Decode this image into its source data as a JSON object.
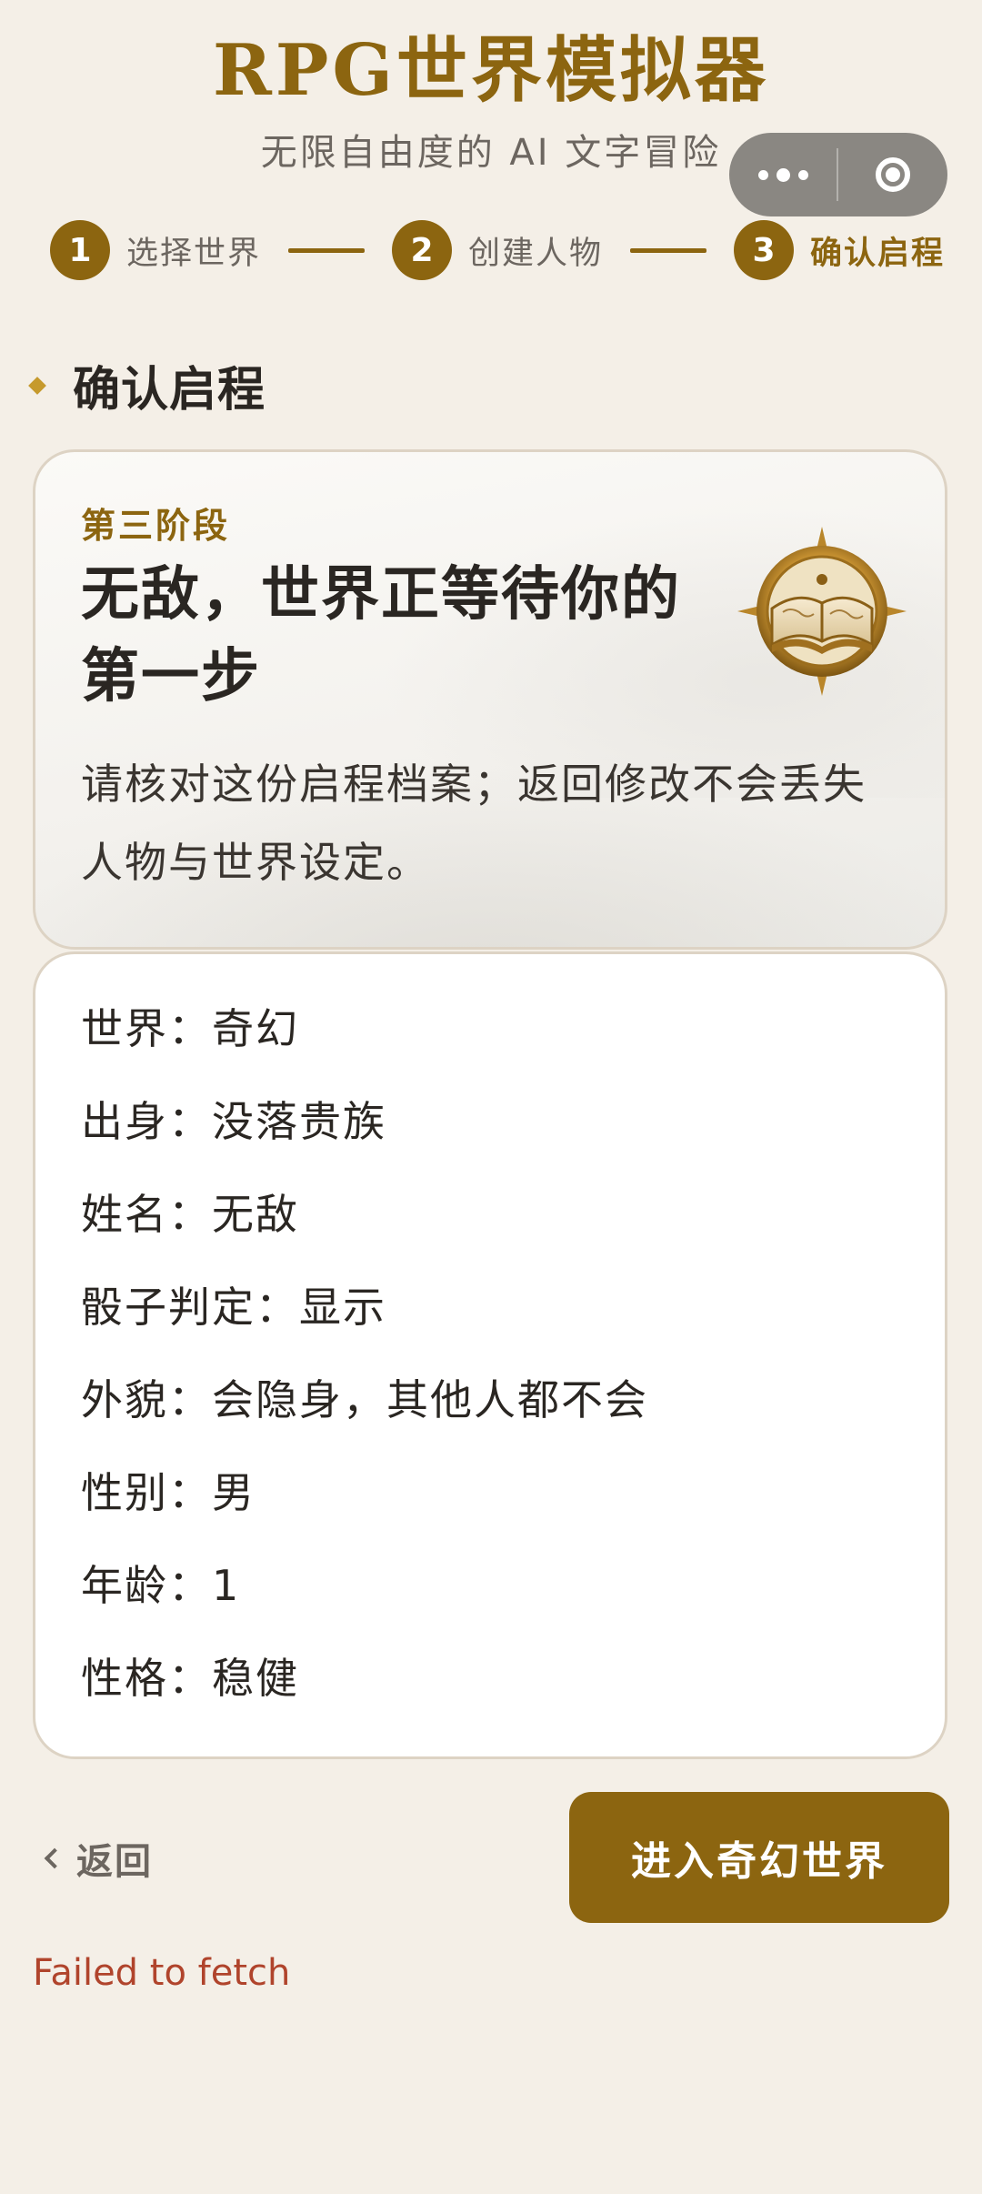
{
  "header": {
    "title": "RPG世界模拟器",
    "subtitle": "无限自由度的 AI 文字冒险"
  },
  "capsule": {
    "more_icon": "more-dots-icon",
    "close_icon": "target-circle-icon"
  },
  "stepper": {
    "steps": [
      {
        "number": "1",
        "label": "选择世界",
        "active": false
      },
      {
        "number": "2",
        "label": "创建人物",
        "active": false
      },
      {
        "number": "3",
        "label": "确认启程",
        "active": true
      }
    ]
  },
  "section": {
    "title": "确认启程"
  },
  "hero": {
    "stage_label": "第三阶段",
    "title": "无敌，世界正等待你的第一步",
    "description": "请核对这份启程档案；返回修改不会丢失人物与世界设定。",
    "emblem_icon": "book-compass-icon"
  },
  "profile": {
    "rows": [
      "世界：奇幻",
      "出身：没落贵族",
      "姓名：无敌",
      "骰子判定：显示",
      "外貌：会隐身，其他人都不会",
      "性别：男",
      "年龄：1",
      "性格：稳健"
    ]
  },
  "actions": {
    "back_label": "返回",
    "enter_label": "进入奇幻世界"
  },
  "status": {
    "error": "Failed to fetch"
  },
  "colors": {
    "accent": "#8c6510",
    "background": "#f4efe7",
    "error": "#b0442c"
  }
}
